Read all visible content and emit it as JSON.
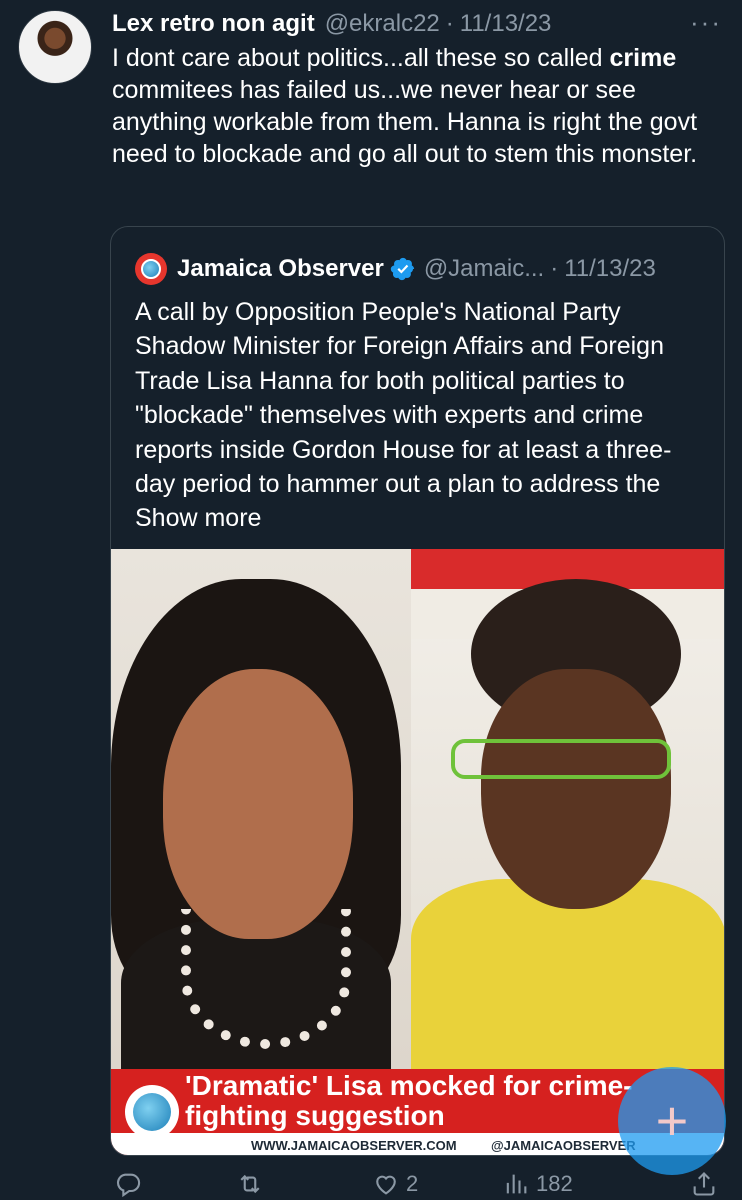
{
  "tweet": {
    "author_name": "Lex retro non agit",
    "author_handle": "@ekralc22",
    "separator": "·",
    "date": "11/13/23",
    "more_icon": "more-horizontal-icon",
    "text_line_1": "I dont care about politics...all these so called",
    "text_bold": "crime",
    "text_rest": "commitees has failed us...we never hear or see anything workable from them. Hanna is right the govt need to blockade and go all out to stem this monster."
  },
  "quoted_tweet": {
    "author_name": "Jamaica Observer",
    "author_handle": "@Jamaic...",
    "separator": "·",
    "date": "11/13/23",
    "verified_icon": "verified-badge-icon",
    "text": "A call by Opposition People's National Party Shadow Minister for Foreign Affairs and Foreign Trade Lisa Hanna for both political parties to \"blockade\" themselves with experts and crime reports inside Gordon House for at least a three-day period to hammer out a plan to address the Show more",
    "image": {
      "headline": "'Dramatic' Lisa mocked for crime-fighting suggestion",
      "footer_url": "WWW.JAMAICAOBSERVER.COM",
      "footer_handle": "@JAMAICAOBSERVER"
    }
  },
  "actions": {
    "reply_count": "",
    "retweet_count": "",
    "like_count": "2",
    "views_count": "182"
  },
  "fab": {
    "label": "+"
  },
  "colors": {
    "background": "#15202b",
    "secondary_text": "#8b98a5",
    "accent": "#1d9bf0",
    "border": "#38444d"
  }
}
